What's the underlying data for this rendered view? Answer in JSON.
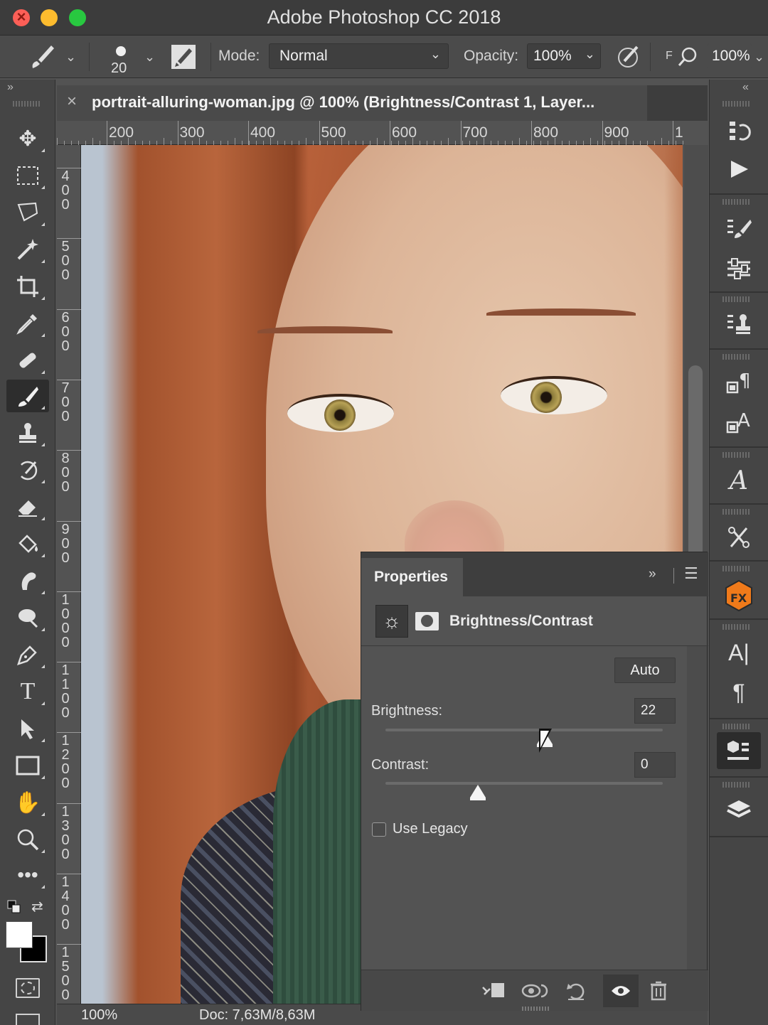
{
  "window": {
    "title": "Adobe Photoshop CC 2018",
    "controls": [
      "close",
      "minimize",
      "zoom"
    ]
  },
  "options_bar": {
    "brush_size": "20",
    "mode_label": "Mode:",
    "mode_value": "Normal",
    "opacity_label": "Opacity:",
    "opacity_value": "100%",
    "flow_truncated": "F",
    "flow_value": "100%"
  },
  "document": {
    "tab_title": "portrait-alluring-woman.jpg @ 100% (Brightness/Contrast 1, Layer...",
    "close_glyph": "×"
  },
  "rulers": {
    "top": [
      "200",
      "300",
      "400",
      "500",
      "600",
      "700",
      "800",
      "900",
      "1"
    ],
    "left": [
      "4 0 0",
      "5 0 0",
      "6 0 0",
      "7 0 0",
      "8 0 0",
      "9 0 0",
      "1 0 0 0",
      "1 1 0 0",
      "1 2 0 0",
      "1 3 0 0",
      "1 4 0 0",
      "1 5 0 0"
    ]
  },
  "status": {
    "zoom": "100%",
    "doc": "Doc: 7,63M/8,63M"
  },
  "tools": [
    "move-icon",
    "marquee-icon",
    "lasso-icon",
    "magic-wand-icon",
    "crop-icon",
    "eyedropper-icon",
    "healing-icon",
    "brush-icon",
    "clone-stamp-icon",
    "history-brush-icon",
    "eraser-icon",
    "paint-bucket-icon",
    "smudge-icon",
    "dodge-icon",
    "pen-icon",
    "type-icon",
    "path-select-icon",
    "rectangle-icon",
    "hand-icon",
    "zoom-icon",
    "more-tools-icon"
  ],
  "properties": {
    "tab_label": "Properties",
    "adjustment_title": "Brightness/Contrast",
    "auto_label": "Auto",
    "brightness_label": "Brightness:",
    "brightness_value": "22",
    "contrast_label": "Contrast:",
    "contrast_value": "0",
    "legacy_label": "Use Legacy",
    "legacy_checked": false,
    "brightness_range": [
      -150,
      150
    ],
    "contrast_range": [
      -50,
      100
    ]
  },
  "right_panel_icons": [
    "history-icon",
    "actions-play-icon",
    "brush-settings-icon",
    "adjustments-icon",
    "clone-source-icon",
    "paragraph-styles-icon",
    "character-styles-icon",
    "glyphs-icon",
    "tools-presets-icon",
    "fx-plugin-icon",
    "character-icon",
    "paragraph-icon",
    "3d-icon",
    "layers-icon"
  ]
}
